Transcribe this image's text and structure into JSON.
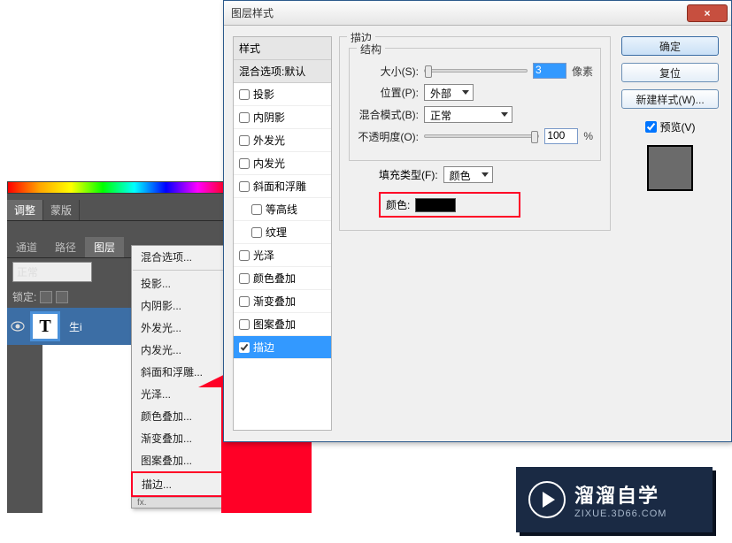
{
  "ps_panel": {
    "tabs_adjust": "调整",
    "tabs_mask": "蒙版",
    "subtabs": [
      "通道",
      "路径",
      "图层"
    ],
    "blend_mode": "正常",
    "lock_label": "锁定:",
    "layer_thumb_letter": "T",
    "layer_name": "生i"
  },
  "context_menu": {
    "items_top": [
      "混合选项..."
    ],
    "items": [
      "投影...",
      "内阴影...",
      "外发光...",
      "内发光...",
      "斜面和浮雕...",
      "光泽...",
      "颜色叠加...",
      "渐变叠加...",
      "图案叠加...",
      "描边..."
    ],
    "footer": "fx."
  },
  "dialog": {
    "title": "图层样式",
    "close": "×",
    "style_header": "样式",
    "blend_defaults": "混合选项:默认",
    "styles": [
      {
        "label": "投影",
        "checked": false
      },
      {
        "label": "内阴影",
        "checked": false
      },
      {
        "label": "外发光",
        "checked": false
      },
      {
        "label": "内发光",
        "checked": false
      },
      {
        "label": "斜面和浮雕",
        "checked": false
      },
      {
        "label": "等高线",
        "checked": false,
        "indent": true
      },
      {
        "label": "纹理",
        "checked": false,
        "indent": true
      },
      {
        "label": "光泽",
        "checked": false
      },
      {
        "label": "颜色叠加",
        "checked": false
      },
      {
        "label": "渐变叠加",
        "checked": false
      },
      {
        "label": "图案叠加",
        "checked": false
      },
      {
        "label": "描边",
        "checked": true,
        "selected": true
      }
    ],
    "stroke_title": "描边",
    "structure_title": "结构",
    "size_label": "大小(S):",
    "size_value": "3",
    "size_unit": "像素",
    "position_label": "位置(P):",
    "position_value": "外部",
    "blend_label": "混合模式(B):",
    "blend_value": "正常",
    "opacity_label": "不透明度(O):",
    "opacity_value": "100",
    "opacity_unit": "%",
    "fill_label": "填充类型(F):",
    "fill_value": "颜色",
    "color_label": "颜色:",
    "buttons": {
      "ok": "确定",
      "reset": "复位",
      "new_style": "新建样式(W)...",
      "preview": "预览(V)"
    }
  },
  "logo": {
    "name": "溜溜自学",
    "url": "ZIXUE.3D66.COM"
  }
}
